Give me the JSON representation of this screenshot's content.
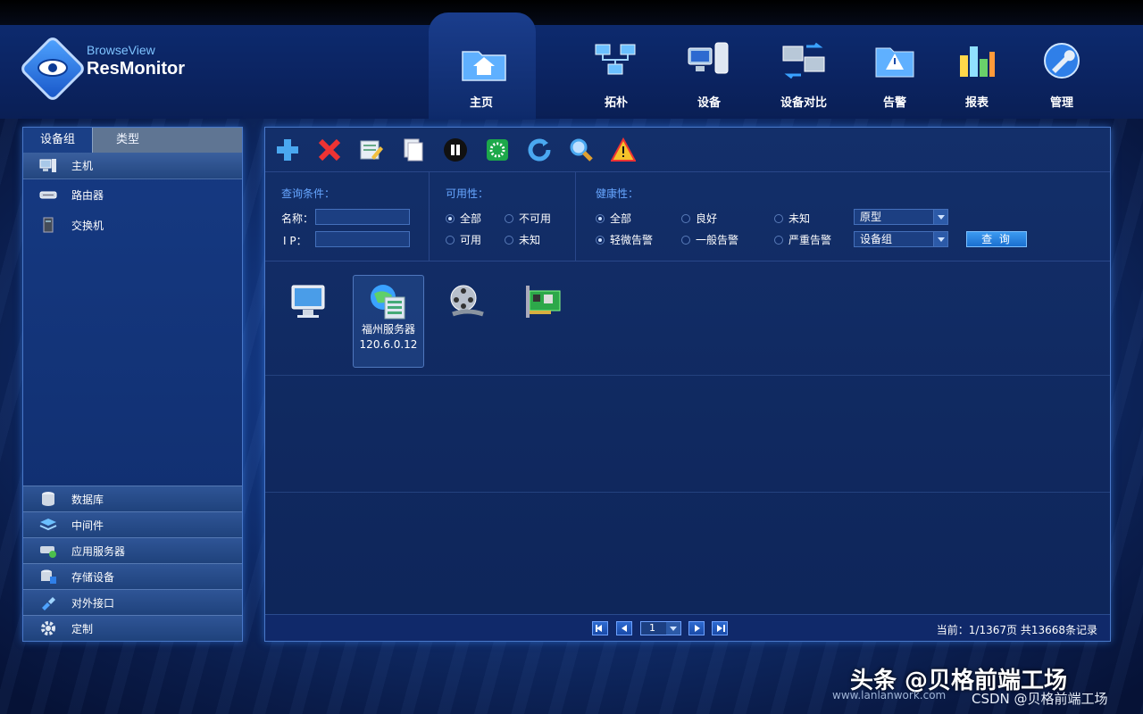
{
  "logo": {
    "top": "BrowseView",
    "main": "ResMonitor"
  },
  "nav": [
    {
      "label": "主页"
    },
    {
      "label": "拓朴"
    },
    {
      "label": "设备"
    },
    {
      "label": "设备对比"
    },
    {
      "label": "告警"
    },
    {
      "label": "报表"
    },
    {
      "label": "管理"
    }
  ],
  "sidebar": {
    "tabs": [
      "设备组",
      "类型"
    ],
    "head": "主机",
    "items": [
      "路由器",
      "交换机"
    ],
    "bottom": [
      "数据库",
      "中间件",
      "应用服务器",
      "存储设备",
      "对外接口",
      "定制"
    ]
  },
  "query": {
    "title": "查询条件：",
    "name_label": "名称：",
    "ip_label": "I P：",
    "availability_title": "可用性：",
    "availability": [
      "全部",
      "不可用",
      "可用",
      "未知"
    ],
    "health_title": "健康性：",
    "health": [
      "全部",
      "良好",
      "未知",
      "轻微告警",
      "一般告警",
      "严重告警"
    ],
    "select_type": "原型",
    "select_group": "设备组",
    "button": "查 询"
  },
  "devices": [
    {
      "name": "",
      "ip": ""
    },
    {
      "name": "福州服务器",
      "ip": "120.6.0.12"
    },
    {
      "name": "",
      "ip": ""
    },
    {
      "name": "",
      "ip": ""
    }
  ],
  "pager": {
    "page": "1",
    "info": "当前：1/1367页  共13668条记录"
  },
  "watermark": {
    "main": "头条 @贝格前端工场",
    "site": "www.lanlanwork.com",
    "csdn": "CSDN @贝格前端工场"
  }
}
